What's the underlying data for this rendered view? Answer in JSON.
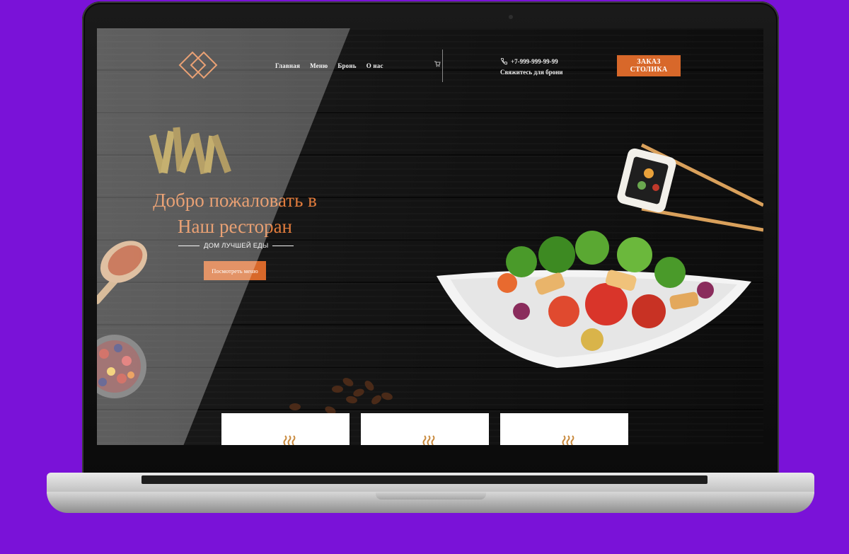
{
  "nav": {
    "items": [
      "Главная",
      "Меню",
      "Бронь",
      "О нас"
    ]
  },
  "contact": {
    "phone": "+7-999-999-99-99",
    "subtitle": "Свяжитесь для брони"
  },
  "order_button": "ЗАКАЗ СТОЛИКА",
  "hero": {
    "title_line1": "Добро пожаловать в",
    "title_line2": "Наш ресторан",
    "tagline": "ДОМ ЛУЧШЕЙ ЕДЫ",
    "cta": "Посмотреть меню"
  },
  "colors": {
    "accent": "#d8682a",
    "title": "#e07b3c",
    "background": "#7a12d8"
  },
  "icons": [
    "diamond-logo-icon",
    "cart-icon",
    "phone-icon",
    "steam-icon"
  ]
}
